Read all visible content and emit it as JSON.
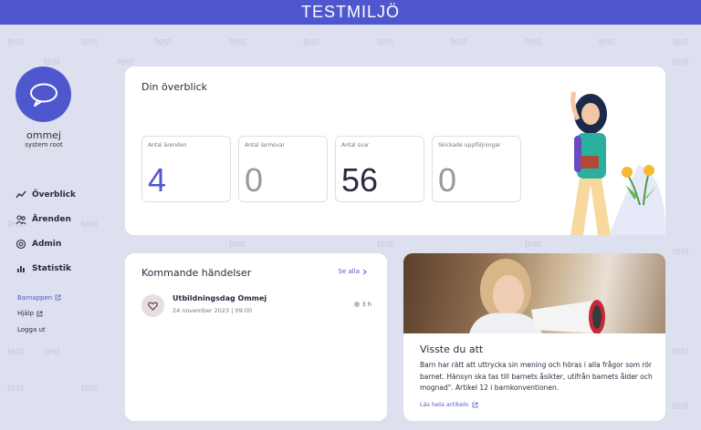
{
  "banner": {
    "title": "TESTMILJÖ"
  },
  "watermark": {
    "text": "test"
  },
  "brand": {
    "name": "ommej",
    "role": "system root"
  },
  "nav": [
    {
      "label": "Överblick",
      "icon": "trend-icon"
    },
    {
      "label": "Ärenden",
      "icon": "people-icon"
    },
    {
      "label": "Admin",
      "icon": "settings-icon"
    },
    {
      "label": "Statistik",
      "icon": "bar-chart-icon"
    }
  ],
  "links": [
    {
      "label": "Barnappen",
      "external": true
    },
    {
      "label": "Hjälp",
      "external": true
    },
    {
      "label": "Logga ut",
      "external": false
    }
  ],
  "overview": {
    "title": "Din överblick",
    "stats": [
      {
        "label": "Antal ärenden",
        "value": "4",
        "color": "#4f57cf"
      },
      {
        "label": "Antal larmsvar",
        "value": "0",
        "color": "#9a9a9a"
      },
      {
        "label": "Antal svar",
        "value": "56",
        "color": "#2b2b40"
      },
      {
        "label": "Skickade uppföljningar",
        "value": "0",
        "color": "#9a9a9a"
      }
    ]
  },
  "events": {
    "title": "Kommande händelser",
    "see_all": "Se alla",
    "items": [
      {
        "name": "Utbildningsdag Ommej",
        "date": "24 november 2023",
        "time": "09:00",
        "duration": "3 h"
      }
    ]
  },
  "info": {
    "title": "Visste du att",
    "body": "Barn har rätt att uttrycka sin mening och höras i alla frågor som rör barnet. Hänsyn ska tas till barnets åsikter, utifrån barnets ålder och mognad\". Artikel 12 i barnkonventionen.",
    "read_more": "Läs hela artikeln"
  },
  "colors": {
    "accent": "#4f57cf",
    "background": "#dde0ee"
  }
}
